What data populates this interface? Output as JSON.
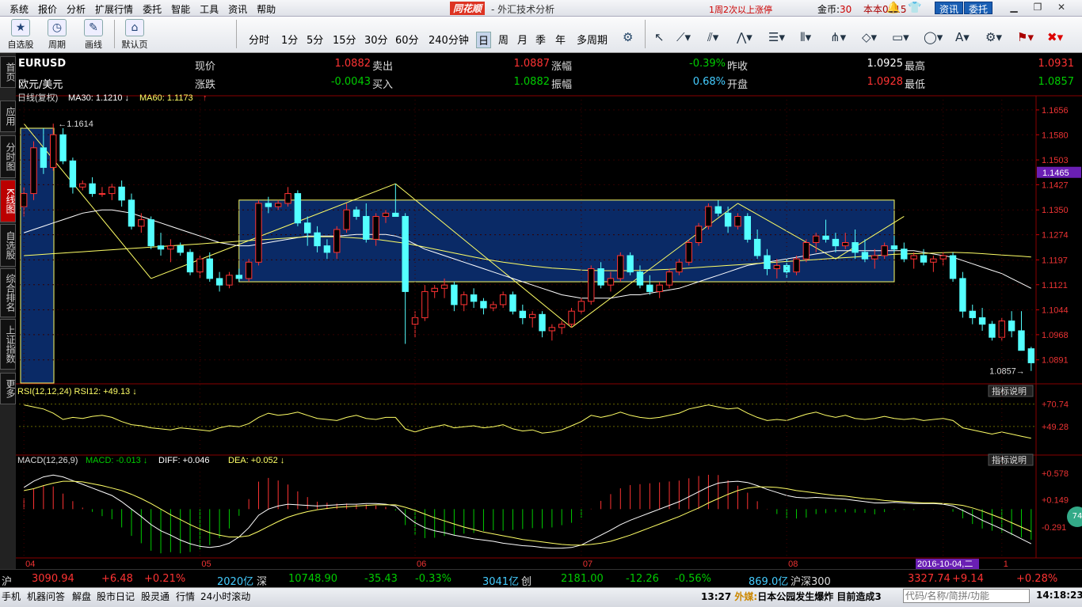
{
  "menubar": {
    "items": [
      "系统",
      "报价",
      "分析",
      "扩展行情",
      "委托",
      "智能",
      "工具",
      "资讯",
      "帮助"
    ],
    "logo": "同花顺",
    "title": "- 外汇技术分析",
    "notice": "1周2次以上涨停",
    "coins_label": "金币:",
    "coins_value": "30",
    "version": "本本0915",
    "zixun": "资讯",
    "weituo": "委托"
  },
  "toolbar": {
    "zixuangu": "自选股",
    "zhouqi": "周期",
    "huaxian": "画线",
    "morenye": "默认页",
    "periods": [
      "分时",
      "1分",
      "5分",
      "15分",
      "30分",
      "60分",
      "240分钟",
      "日",
      "周",
      "月",
      "季",
      "年",
      "多周期"
    ],
    "selected_period": "日"
  },
  "sidebar": {
    "tabs": [
      "首页",
      "应用",
      "分时图",
      "K线图",
      "自选股",
      "综合排名",
      "上证指数",
      "更多"
    ],
    "active": "K线图"
  },
  "quote": {
    "symbol": "EURUSD",
    "name": "欧元/美元",
    "rows": [
      {
        "l1": "现价",
        "v1": "1.0882",
        "l2": "卖出",
        "v2": "1.0887",
        "l3": "涨幅",
        "v3": "-0.39%",
        "l4": "昨收",
        "v4": "1.0925",
        "l5": "最高",
        "v5": "1.0931"
      },
      {
        "l1": "涨跌",
        "v1": "-0.0043",
        "l2": "买入",
        "v2": "1.0882",
        "l3": "振幅",
        "v3": "0.68%",
        "l4": "开盘",
        "v4": "1.0928",
        "l5": "最低",
        "v5": "1.0857"
      }
    ]
  },
  "chart_data": {
    "type": "candlestick",
    "main_label": "日线(复权)",
    "ma30_label": "MA30: 1.1210",
    "ma60_label": "MA60: 1.1173",
    "ylim": [
      1.082,
      1.168
    ],
    "y_ticks": [
      "1.1656",
      "1.1580",
      "1.1503",
      "1.1427",
      "1.1350",
      "1.1274",
      "1.1197",
      "1.1121",
      "1.1044",
      "1.0968",
      "1.0891"
    ],
    "current_price_tag": "1.1465",
    "high_annotation": "1.1614",
    "low_annotation": "1.0857",
    "x_labels": [
      "04",
      "05",
      "06",
      "07",
      "08",
      "09",
      "1"
    ],
    "date_tag": "2016-10-04,二",
    "candles": [
      [
        1.136,
        1.142,
        1.133,
        1.14
      ],
      [
        1.14,
        1.156,
        1.138,
        1.154
      ],
      [
        1.154,
        1.16,
        1.146,
        1.148
      ],
      [
        1.148,
        1.1614,
        1.147,
        1.158
      ],
      [
        1.158,
        1.16,
        1.149,
        1.15
      ],
      [
        1.15,
        1.151,
        1.14,
        1.142
      ],
      [
        1.142,
        1.144,
        1.141,
        1.143
      ],
      [
        1.143,
        1.145,
        1.139,
        1.14
      ],
      [
        1.14,
        1.142,
        1.139,
        1.14
      ],
      [
        1.14,
        1.143,
        1.138,
        1.142
      ],
      [
        1.142,
        1.144,
        1.136,
        1.138
      ],
      [
        1.138,
        1.14,
        1.129,
        1.13
      ],
      [
        1.13,
        1.134,
        1.128,
        1.132
      ],
      [
        1.132,
        1.133,
        1.123,
        1.124
      ],
      [
        1.124,
        1.128,
        1.121,
        1.123
      ],
      [
        1.123,
        1.126,
        1.119,
        1.124
      ],
      [
        1.124,
        1.125,
        1.121,
        1.122
      ],
      [
        1.122,
        1.123,
        1.115,
        1.116
      ],
      [
        1.116,
        1.121,
        1.114,
        1.12
      ],
      [
        1.12,
        1.122,
        1.113,
        1.114
      ],
      [
        1.114,
        1.116,
        1.11,
        1.112
      ],
      [
        1.112,
        1.116,
        1.111,
        1.115
      ],
      [
        1.115,
        1.117,
        1.113,
        1.114
      ],
      [
        1.114,
        1.12,
        1.113,
        1.119
      ],
      [
        1.119,
        1.138,
        1.118,
        1.137
      ],
      [
        1.137,
        1.139,
        1.134,
        1.136
      ],
      [
        1.136,
        1.138,
        1.135,
        1.137
      ],
      [
        1.137,
        1.142,
        1.136,
        1.14
      ],
      [
        1.14,
        1.141,
        1.13,
        1.131
      ],
      [
        1.131,
        1.133,
        1.124,
        1.128
      ],
      [
        1.128,
        1.13,
        1.122,
        1.124
      ],
      [
        1.124,
        1.126,
        1.12,
        1.122
      ],
      [
        1.122,
        1.13,
        1.12,
        1.129
      ],
      [
        1.129,
        1.137,
        1.128,
        1.135
      ],
      [
        1.135,
        1.136,
        1.132,
        1.133
      ],
      [
        1.133,
        1.137,
        1.125,
        1.126
      ],
      [
        1.126,
        1.134,
        1.124,
        1.133
      ],
      [
        1.133,
        1.135,
        1.131,
        1.134
      ],
      [
        1.134,
        1.143,
        1.133,
        1.133
      ],
      [
        1.133,
        1.134,
        1.094,
        1.11
      ],
      [
        1.1,
        1.104,
        1.096,
        1.102
      ],
      [
        1.102,
        1.112,
        1.101,
        1.11
      ],
      [
        1.11,
        1.112,
        1.108,
        1.111
      ],
      [
        1.111,
        1.114,
        1.108,
        1.112
      ],
      [
        1.112,
        1.113,
        1.104,
        1.106
      ],
      [
        1.106,
        1.11,
        1.104,
        1.109
      ],
      [
        1.109,
        1.111,
        1.105,
        1.107
      ],
      [
        1.107,
        1.108,
        1.103,
        1.105
      ],
      [
        1.105,
        1.107,
        1.104,
        1.106
      ],
      [
        1.106,
        1.11,
        1.105,
        1.109
      ],
      [
        1.109,
        1.11,
        1.103,
        1.104
      ],
      [
        1.104,
        1.106,
        1.1,
        1.102
      ],
      [
        1.102,
        1.104,
        1.099,
        1.103
      ],
      [
        1.103,
        1.104,
        1.096,
        1.098
      ],
      [
        1.098,
        1.1,
        1.095,
        1.099
      ],
      [
        1.099,
        1.101,
        1.097,
        1.1
      ],
      [
        1.1,
        1.105,
        1.099,
        1.104
      ],
      [
        1.104,
        1.108,
        1.103,
        1.107
      ],
      [
        1.107,
        1.118,
        1.106,
        1.117
      ],
      [
        1.117,
        1.119,
        1.111,
        1.112
      ],
      [
        1.112,
        1.116,
        1.11,
        1.114
      ],
      [
        1.114,
        1.122,
        1.113,
        1.121
      ],
      [
        1.121,
        1.122,
        1.115,
        1.116
      ],
      [
        1.116,
        1.118,
        1.111,
        1.112
      ],
      [
        1.112,
        1.115,
        1.109,
        1.11
      ],
      [
        1.11,
        1.113,
        1.108,
        1.112
      ],
      [
        1.112,
        1.117,
        1.111,
        1.116
      ],
      [
        1.116,
        1.12,
        1.115,
        1.119
      ],
      [
        1.119,
        1.126,
        1.118,
        1.125
      ],
      [
        1.125,
        1.131,
        1.124,
        1.13
      ],
      [
        1.13,
        1.137,
        1.129,
        1.136
      ],
      [
        1.136,
        1.138,
        1.133,
        1.134
      ],
      [
        1.134,
        1.136,
        1.128,
        1.13
      ],
      [
        1.13,
        1.134,
        1.129,
        1.133
      ],
      [
        1.133,
        1.134,
        1.125,
        1.126
      ],
      [
        1.126,
        1.129,
        1.12,
        1.121
      ],
      [
        1.121,
        1.123,
        1.115,
        1.117
      ],
      [
        1.117,
        1.12,
        1.114,
        1.118
      ],
      [
        1.118,
        1.12,
        1.114,
        1.116
      ],
      [
        1.116,
        1.121,
        1.115,
        1.12
      ],
      [
        1.12,
        1.126,
        1.119,
        1.125
      ],
      [
        1.125,
        1.128,
        1.122,
        1.127
      ],
      [
        1.127,
        1.132,
        1.125,
        1.126
      ],
      [
        1.126,
        1.128,
        1.122,
        1.124
      ],
      [
        1.124,
        1.128,
        1.123,
        1.125
      ],
      [
        1.125,
        1.129,
        1.12,
        1.122
      ],
      [
        1.122,
        1.126,
        1.119,
        1.12
      ],
      [
        1.12,
        1.123,
        1.117,
        1.121
      ],
      [
        1.121,
        1.125,
        1.12,
        1.124
      ],
      [
        1.124,
        1.127,
        1.122,
        1.123
      ],
      [
        1.123,
        1.125,
        1.119,
        1.12
      ],
      [
        1.12,
        1.122,
        1.117,
        1.121
      ],
      [
        1.121,
        1.123,
        1.118,
        1.119
      ],
      [
        1.119,
        1.121,
        1.116,
        1.12
      ],
      [
        1.12,
        1.122,
        1.118,
        1.121
      ],
      [
        1.121,
        1.122,
        1.113,
        1.114
      ],
      [
        1.114,
        1.116,
        1.102,
        1.104
      ],
      [
        1.104,
        1.106,
        1.1,
        1.102
      ],
      [
        1.102,
        1.105,
        1.098,
        1.1
      ],
      [
        1.1,
        1.101,
        1.095,
        1.096
      ],
      [
        1.096,
        1.102,
        1.095,
        1.101
      ],
      [
        1.101,
        1.104,
        1.096,
        1.098
      ],
      [
        1.098,
        1.104,
        1.092,
        1.092
      ],
      [
        1.0925,
        1.0931,
        1.0857,
        1.0882
      ]
    ],
    "ma30": [
      1.128,
      1.129,
      1.13,
      1.131,
      1.132,
      1.133,
      1.134,
      1.1345,
      1.135,
      1.135,
      1.1345,
      1.134,
      1.133,
      1.132,
      1.131,
      1.13,
      1.129,
      1.128,
      1.127,
      1.126,
      1.125,
      1.1245,
      1.124,
      1.124,
      1.1245,
      1.125,
      1.1255,
      1.126,
      1.1265,
      1.127,
      1.127,
      1.127,
      1.127,
      1.1272,
      1.1275,
      1.1275,
      1.1275,
      1.1275,
      1.127,
      1.126,
      1.1245,
      1.123,
      1.122,
      1.121,
      1.12,
      1.119,
      1.118,
      1.117,
      1.116,
      1.115,
      1.114,
      1.113,
      1.112,
      1.111,
      1.11,
      1.109,
      1.1085,
      1.108,
      1.108,
      1.108,
      1.108,
      1.1085,
      1.109,
      1.109,
      1.1095,
      1.11,
      1.1105,
      1.111,
      1.112,
      1.113,
      1.114,
      1.115,
      1.116,
      1.117,
      1.118,
      1.1185,
      1.119,
      1.1195,
      1.12,
      1.1205,
      1.121,
      1.1215,
      1.122,
      1.1225,
      1.1225,
      1.1225,
      1.1225,
      1.1225,
      1.1225,
      1.1225,
      1.1225,
      1.1225,
      1.122,
      1.1215,
      1.121,
      1.1205,
      1.1195,
      1.1185,
      1.1175,
      1.1165,
      1.1155,
      1.114,
      1.1125,
      1.111
    ],
    "ma60": [
      1.121,
      1.1212,
      1.1214,
      1.1216,
      1.1218,
      1.122,
      1.1222,
      1.1224,
      1.1226,
      1.1228,
      1.123,
      1.1232,
      1.1234,
      1.1236,
      1.1238,
      1.124,
      1.1242,
      1.1244,
      1.1246,
      1.1248,
      1.125,
      1.1252,
      1.1254,
      1.1256,
      1.1258,
      1.126,
      1.1262,
      1.1264,
      1.1266,
      1.1268,
      1.1268,
      1.1268,
      1.1268,
      1.1266,
      1.1264,
      1.1262,
      1.126,
      1.1256,
      1.1252,
      1.1248,
      1.1242,
      1.1236,
      1.123,
      1.1224,
      1.1218,
      1.1212,
      1.1206,
      1.12,
      1.1195,
      1.119,
      1.1186,
      1.1182,
      1.1178,
      1.1175,
      1.1172,
      1.117,
      1.1168,
      1.1166,
      1.1165,
      1.1164,
      1.1164,
      1.1164,
      1.1164,
      1.1165,
      1.1166,
      1.1167,
      1.1168,
      1.117,
      1.1172,
      1.1174,
      1.1176,
      1.1178,
      1.118,
      1.1182,
      1.1184,
      1.1186,
      1.1188,
      1.119,
      1.1192,
      1.1194,
      1.1196,
      1.1198,
      1.12,
      1.1202,
      1.1204,
      1.1206,
      1.1208,
      1.121,
      1.1212,
      1.1214,
      1.1215,
      1.1216,
      1.1217,
      1.1218,
      1.1219,
      1.122,
      1.1219,
      1.1218,
      1.1216,
      1.1214,
      1.1212,
      1.121,
      1.1208,
      1.1206
    ],
    "boxes": [
      [
        22,
        1.138,
        89,
        1.113
      ]
    ],
    "trendlines": [
      [
        0,
        1.1614,
        13,
        1.114
      ],
      [
        13,
        1.114,
        38,
        1.143
      ],
      [
        38,
        1.143,
        56,
        1.099
      ],
      [
        56,
        1.099,
        73,
        1.137
      ],
      [
        73,
        1.137,
        83,
        1.12
      ],
      [
        83,
        1.12,
        90,
        1.133
      ]
    ],
    "rsi": {
      "label": "RSI(12,12,24)",
      "value_label": "RSI12: +49.13",
      "explain": "指标说明",
      "ticks": [
        "+70.74",
        "+49.28"
      ],
      "ylim": [
        28,
        78
      ],
      "values": [
        70,
        68,
        66,
        62,
        56,
        58,
        57,
        59,
        60,
        58,
        54,
        51,
        50,
        48,
        47,
        46,
        48,
        47,
        46,
        45,
        48,
        50,
        49,
        52,
        58,
        62,
        60,
        61,
        63,
        60,
        57,
        56,
        55,
        58,
        60,
        57,
        56,
        58,
        58,
        47,
        44,
        47,
        49,
        51,
        48,
        49,
        50,
        48,
        49,
        51,
        47,
        45,
        46,
        43,
        44,
        46,
        50,
        54,
        60,
        58,
        60,
        63,
        60,
        58,
        57,
        58,
        60,
        62,
        66,
        68,
        70,
        68,
        66,
        67,
        62,
        58,
        55,
        56,
        55,
        58,
        61,
        63,
        60,
        58,
        60,
        57,
        56,
        57,
        59,
        57,
        56,
        57,
        55,
        56,
        57,
        55,
        48,
        46,
        44,
        42,
        44,
        42,
        40,
        38
      ]
    },
    "macd": {
      "label": "MACD(12,26,9)",
      "macd_label": "MACD: -0.013",
      "diff_label": "DIFF: +0.046",
      "dea_label": "DEA: +0.052",
      "explain": "指标说明",
      "ticks": [
        "+0.578",
        "+0.149",
        "-0.291"
      ],
      "ylim": [
        -0.75,
        0.72
      ],
      "diff": [
        0.35,
        0.45,
        0.52,
        0.55,
        0.52,
        0.46,
        0.4,
        0.34,
        0.28,
        0.22,
        0.12,
        0.0,
        -0.12,
        -0.25,
        -0.35,
        -0.42,
        -0.5,
        -0.56,
        -0.6,
        -0.62,
        -0.6,
        -0.55,
        -0.45,
        -0.3,
        -0.1,
        0.0,
        0.05,
        0.08,
        0.07,
        0.06,
        0.05,
        0.06,
        0.07,
        0.08,
        0.08,
        0.09,
        0.09,
        0.08,
        0.05,
        -0.1,
        -0.22,
        -0.3,
        -0.35,
        -0.38,
        -0.42,
        -0.45,
        -0.48,
        -0.5,
        -0.52,
        -0.55,
        -0.57,
        -0.59,
        -0.6,
        -0.62,
        -0.63,
        -0.63,
        -0.62,
        -0.58,
        -0.5,
        -0.42,
        -0.34,
        -0.25,
        -0.18,
        -0.12,
        -0.06,
        0.0,
        0.06,
        0.12,
        0.2,
        0.28,
        0.36,
        0.42,
        0.44,
        0.45,
        0.43,
        0.38,
        0.32,
        0.27,
        0.22,
        0.19,
        0.18,
        0.19,
        0.18,
        0.17,
        0.16,
        0.14,
        0.12,
        0.1,
        0.1,
        0.11,
        0.1,
        0.09,
        0.09,
        0.09,
        0.08,
        0.05,
        -0.02,
        -0.1,
        -0.18,
        -0.25,
        -0.32,
        -0.4,
        -0.48,
        -0.56
      ],
      "dea": [
        0.3,
        0.33,
        0.38,
        0.42,
        0.45,
        0.45,
        0.44,
        0.41,
        0.38,
        0.34,
        0.3,
        0.24,
        0.17,
        0.09,
        0.0,
        -0.09,
        -0.17,
        -0.25,
        -0.32,
        -0.38,
        -0.42,
        -0.45,
        -0.45,
        -0.43,
        -0.36,
        -0.28,
        -0.2,
        -0.13,
        -0.08,
        -0.04,
        -0.01,
        0.01,
        0.03,
        0.04,
        0.05,
        0.06,
        0.07,
        0.07,
        0.07,
        0.03,
        -0.02,
        -0.08,
        -0.14,
        -0.19,
        -0.24,
        -0.29,
        -0.33,
        -0.37,
        -0.4,
        -0.43,
        -0.46,
        -0.49,
        -0.51,
        -0.53,
        -0.55,
        -0.57,
        -0.58,
        -0.58,
        -0.57,
        -0.55,
        -0.52,
        -0.47,
        -0.42,
        -0.36,
        -0.3,
        -0.24,
        -0.18,
        -0.12,
        -0.05,
        0.02,
        0.1,
        0.17,
        0.24,
        0.3,
        0.34,
        0.36,
        0.36,
        0.35,
        0.33,
        0.3,
        0.28,
        0.26,
        0.24,
        0.22,
        0.21,
        0.19,
        0.17,
        0.16,
        0.14,
        0.13,
        0.12,
        0.11,
        0.1,
        0.1,
        0.09,
        0.08,
        0.06,
        0.02,
        -0.03,
        -0.09,
        -0.15,
        -0.22,
        -0.29,
        -0.36
      ]
    }
  },
  "bottom": {
    "idx1_name": "沪",
    "idx1_value": "3090.94",
    "idx1_chg": "+6.48",
    "idx1_pct": "+0.21%",
    "idx1_amt": "2020亿",
    "idx2_name": "深",
    "idx2_value": "10748.90",
    "idx2_chg": "-35.43",
    "idx2_pct": "-0.33%",
    "idx2_amt": "3041亿",
    "idx3_name": "创",
    "idx3_value": "2181.00",
    "idx3_chg": "-12.26",
    "idx3_pct": "-0.56%",
    "idx3_amt": "869.0亿",
    "idx4_name": "沪深300",
    "idx4_value": "3327.74",
    "idx4_chg": "+9.14",
    "idx4_pct": "+0.28%"
  },
  "taskbar": {
    "items": [
      "手机",
      "机器问答",
      "解盘",
      "股市日记",
      "股灵通",
      "行情",
      "24小时滚动"
    ],
    "news_time": "13:27",
    "news_src": "外媒:",
    "news_text": "日本公园发生爆炸 目前造成3",
    "code_placeholder": "代码/名称/简拼/功能",
    "clock": "14:18:23",
    "circle": "74"
  },
  "colors": {
    "up": "#ff3333",
    "down": "#54ffff",
    "ma30": "#ffffff",
    "ma60": "#ffff66",
    "box_fill": "#0a2a66",
    "box_stroke": "#ffff66"
  }
}
